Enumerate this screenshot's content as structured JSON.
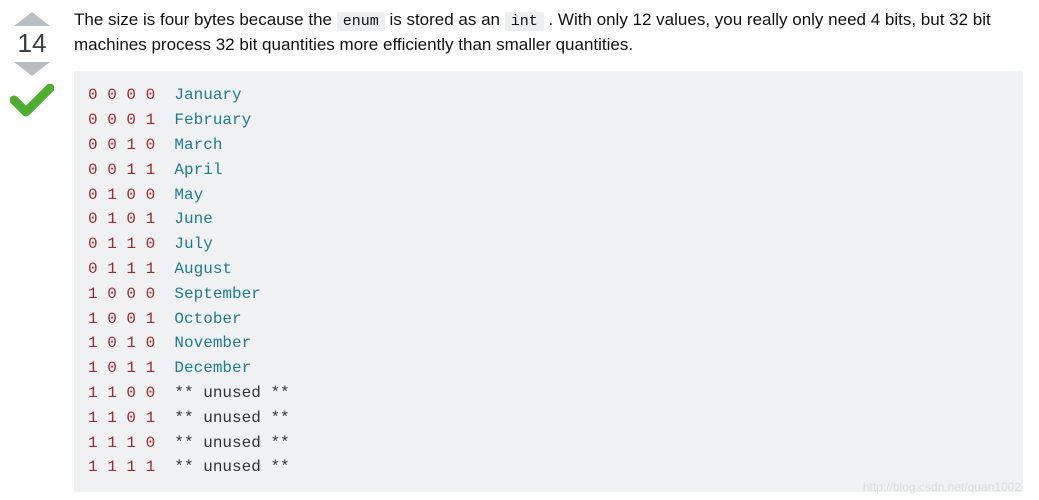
{
  "vote": {
    "score": "14"
  },
  "answer": {
    "text_p1": "The size is four bytes because the ",
    "code1": "enum",
    "text_p2": " is stored as an ",
    "code2": "int",
    "text_p3": " . With only 12 values, you really only need 4 bits, but 32 bit machines process 32 bit quantities more efficiently than smaller quantities."
  },
  "code_rows": [
    {
      "bits": "0 0 0 0",
      "label": "January",
      "kind": "month"
    },
    {
      "bits": "0 0 0 1",
      "label": "February",
      "kind": "month"
    },
    {
      "bits": "0 0 1 0",
      "label": "March",
      "kind": "month"
    },
    {
      "bits": "0 0 1 1",
      "label": "April",
      "kind": "month"
    },
    {
      "bits": "0 1 0 0",
      "label": "May",
      "kind": "month"
    },
    {
      "bits": "0 1 0 1",
      "label": "June",
      "kind": "month"
    },
    {
      "bits": "0 1 1 0",
      "label": "July",
      "kind": "month"
    },
    {
      "bits": "0 1 1 1",
      "label": "August",
      "kind": "month"
    },
    {
      "bits": "1 0 0 0",
      "label": "September",
      "kind": "month"
    },
    {
      "bits": "1 0 0 1",
      "label": "October",
      "kind": "month"
    },
    {
      "bits": "1 0 1 0",
      "label": "November",
      "kind": "month"
    },
    {
      "bits": "1 0 1 1",
      "label": "December",
      "kind": "month"
    },
    {
      "bits": "1 1 0 0",
      "label": "** unused **",
      "kind": "unused"
    },
    {
      "bits": "1 1 0 1",
      "label": "** unused **",
      "kind": "unused"
    },
    {
      "bits": "1 1 1 0",
      "label": "** unused **",
      "kind": "unused"
    },
    {
      "bits": "1 1 1 1",
      "label": "** unused **",
      "kind": "unused"
    }
  ],
  "watermark": "http://blog.csdn.net/quan1002"
}
